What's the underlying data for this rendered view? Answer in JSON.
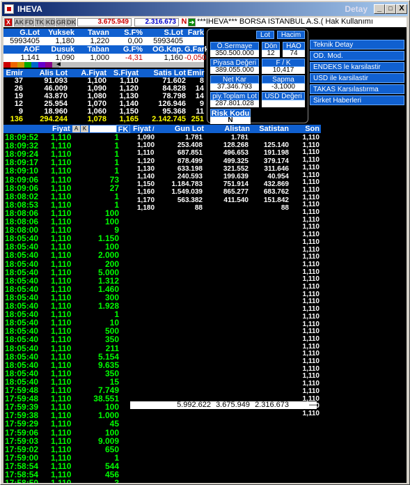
{
  "window": {
    "title": "IHEVA",
    "detail": "Detay",
    "min": "_",
    "max": "□",
    "close": "X"
  },
  "toolbar": {
    "tabs": [
      "X",
      "AK",
      "FD",
      "TK",
      "KD",
      "GR",
      "DK"
    ],
    "price1": "3.675.949",
    "price2": "2.316.673",
    "news_flag": "N",
    "ticker": "***IHEVA*** BORSA ISTANBUL A.S.( Hak Kullanımı"
  },
  "stats1": {
    "headers": [
      "G.Lot",
      "Yuksek",
      "Tavan",
      "S.F%",
      "S.Lot",
      "Fark"
    ],
    "values": [
      "5993405",
      "1,180",
      "1,220",
      "0,00",
      "5993405",
      ""
    ]
  },
  "stats2": {
    "headers": [
      "AOF",
      "Dusuk",
      "Taban",
      "G.F%",
      "OG.Kap.",
      "G.Fark"
    ],
    "values": [
      "1,141",
      "1,090",
      "1,000",
      "-4,31",
      "1,160",
      "-0,050"
    ]
  },
  "depth": {
    "headers": [
      "Emir",
      "Alis Lot",
      "A.Fiyat",
      "S.Fiyat",
      "Satis Lot",
      "Emir"
    ],
    "rows": [
      [
        "37",
        "91.093",
        "1,100",
        "1,110",
        "71.602",
        "8"
      ],
      [
        "26",
        "46.009",
        "1,090",
        "1,120",
        "84.828",
        "14"
      ],
      [
        "19",
        "43.870",
        "1,080",
        "1,130",
        "78.798",
        "14"
      ],
      [
        "12",
        "25.954",
        "1,070",
        "1,140",
        "126.946",
        "9"
      ],
      [
        "9",
        "18.960",
        "1,060",
        "1,150",
        "95.368",
        "11"
      ]
    ],
    "totals": [
      "136",
      "294.244",
      "1,078",
      "1,165",
      "2.142.745",
      "251"
    ]
  },
  "panel": {
    "lot": "Lot",
    "hacim": "Hacim",
    "osermaye_label": "Ö.Sermaye",
    "osermaye": "350.500.000",
    "don_label": "Dön",
    "don": "12",
    "hao_label": "HAO",
    "hao": "74",
    "piyasa_label": "Piyasa Değeri",
    "piyasa": "389.055.000",
    "fk_label": "F / K",
    "fk": "10,417",
    "netkar_label": "Net Kar",
    "netkar": "37.346.793",
    "sapma_label": "Sapma",
    "sapma": "-3,1000",
    "toplam_label": "piy.Toplam Lot",
    "toplam": "287.801.028",
    "usd_label": "USD Değeri",
    "risk_label": "Risk Kodu",
    "risk": "N"
  },
  "menu": [
    "Teknik Detay",
    "OD. Mod.",
    "ENDEKS le karsilastir",
    "USD ile karsilastir",
    "TAKAS Karsılastırma",
    "Sirket Haberleri"
  ],
  "trades": {
    "headers": [
      "",
      "Fiyat",
      "A",
      "K",
      "",
      "FK"
    ],
    "rows": [
      [
        "18:09:52",
        "1,110",
        "1"
      ],
      [
        "18:09:32",
        "1,110",
        "1"
      ],
      [
        "18:09:24",
        "1,110",
        "1"
      ],
      [
        "18:09:17",
        "1,110",
        "1"
      ],
      [
        "18:09:10",
        "1,110",
        "1"
      ],
      [
        "18:09:06",
        "1,110",
        "73"
      ],
      [
        "18:09:06",
        "1,110",
        "27"
      ],
      [
        "18:08:02",
        "1,110",
        "1"
      ],
      [
        "18:08:53",
        "1,110",
        "1"
      ],
      [
        "18:08:06",
        "1,110",
        "100"
      ],
      [
        "18:08:06",
        "1,110",
        "100"
      ],
      [
        "18:08:00",
        "1,110",
        "9"
      ],
      [
        "18:05:40",
        "1,110",
        "1.150"
      ],
      [
        "18:05:40",
        "1,110",
        "100"
      ],
      [
        "18:05:40",
        "1,110",
        "2.000"
      ],
      [
        "18:05:40",
        "1,110",
        "200"
      ],
      [
        "18:05:40",
        "1,110",
        "5.000"
      ],
      [
        "18:05:40",
        "1,110",
        "1.312"
      ],
      [
        "18:05:40",
        "1,110",
        "1.460"
      ],
      [
        "18:05:40",
        "1,110",
        "300"
      ],
      [
        "18:05:40",
        "1,110",
        "1.928"
      ],
      [
        "18:05:40",
        "1,110",
        "1"
      ],
      [
        "18:05:40",
        "1,110",
        "10"
      ],
      [
        "18:05:40",
        "1,110",
        "500"
      ],
      [
        "18:05:40",
        "1,110",
        "350"
      ],
      [
        "18:05:40",
        "1,110",
        "211"
      ],
      [
        "18:05:40",
        "1,110",
        "5.154"
      ],
      [
        "18:05:40",
        "1,110",
        "9.635"
      ],
      [
        "18:05:40",
        "1,110",
        "350"
      ],
      [
        "18:05:40",
        "1,110",
        "15"
      ],
      [
        "17:59:48",
        "1,110",
        "7.749"
      ],
      [
        "17:59:48",
        "1,110",
        "38.551"
      ],
      [
        "17:59:39",
        "1,110",
        "100"
      ],
      [
        "17:59:38",
        "1,110",
        "1.000"
      ],
      [
        "17:59:29",
        "1,110",
        "45"
      ],
      [
        "17:59:06",
        "1,110",
        "100"
      ],
      [
        "17:59:03",
        "1,110",
        "9.009"
      ],
      [
        "17:59:02",
        "1,110",
        "650"
      ],
      [
        "17:59:00",
        "1,110",
        "1"
      ],
      [
        "17:58:54",
        "1,110",
        "544"
      ],
      [
        "17:58:54",
        "1,110",
        "456"
      ],
      [
        "17:58:50",
        "1,110",
        "3"
      ]
    ]
  },
  "volume": {
    "headers": [
      "Fiyat",
      "Gun Lot",
      "Alistan",
      "Satistan",
      "Son"
    ],
    "rows": [
      [
        "1,090",
        "1.781",
        "1.781",
        ""
      ],
      [
        "1,100",
        "253.408",
        "128.268",
        "125.140"
      ],
      [
        "1,110",
        "687.851",
        "496.653",
        "191.198"
      ],
      [
        "1,120",
        "878.499",
        "499.325",
        "379.174"
      ],
      [
        "1,130",
        "633.198",
        "321.552",
        "311.646"
      ],
      [
        "1,140",
        "240.593",
        "199.639",
        "40.954"
      ],
      [
        "1,150",
        "1.184.783",
        "751.914",
        "432.869"
      ],
      [
        "1,160",
        "1.549.039",
        "865.277",
        "683.762"
      ],
      [
        "1,170",
        "563.382",
        "411.540",
        "151.842"
      ],
      [
        "1,180",
        "88",
        "",
        "88"
      ]
    ],
    "totals": [
      "5.992.622",
      "3.675.949",
      "2.316.673"
    ],
    "total_marker": "—",
    "son": "1,110"
  }
}
